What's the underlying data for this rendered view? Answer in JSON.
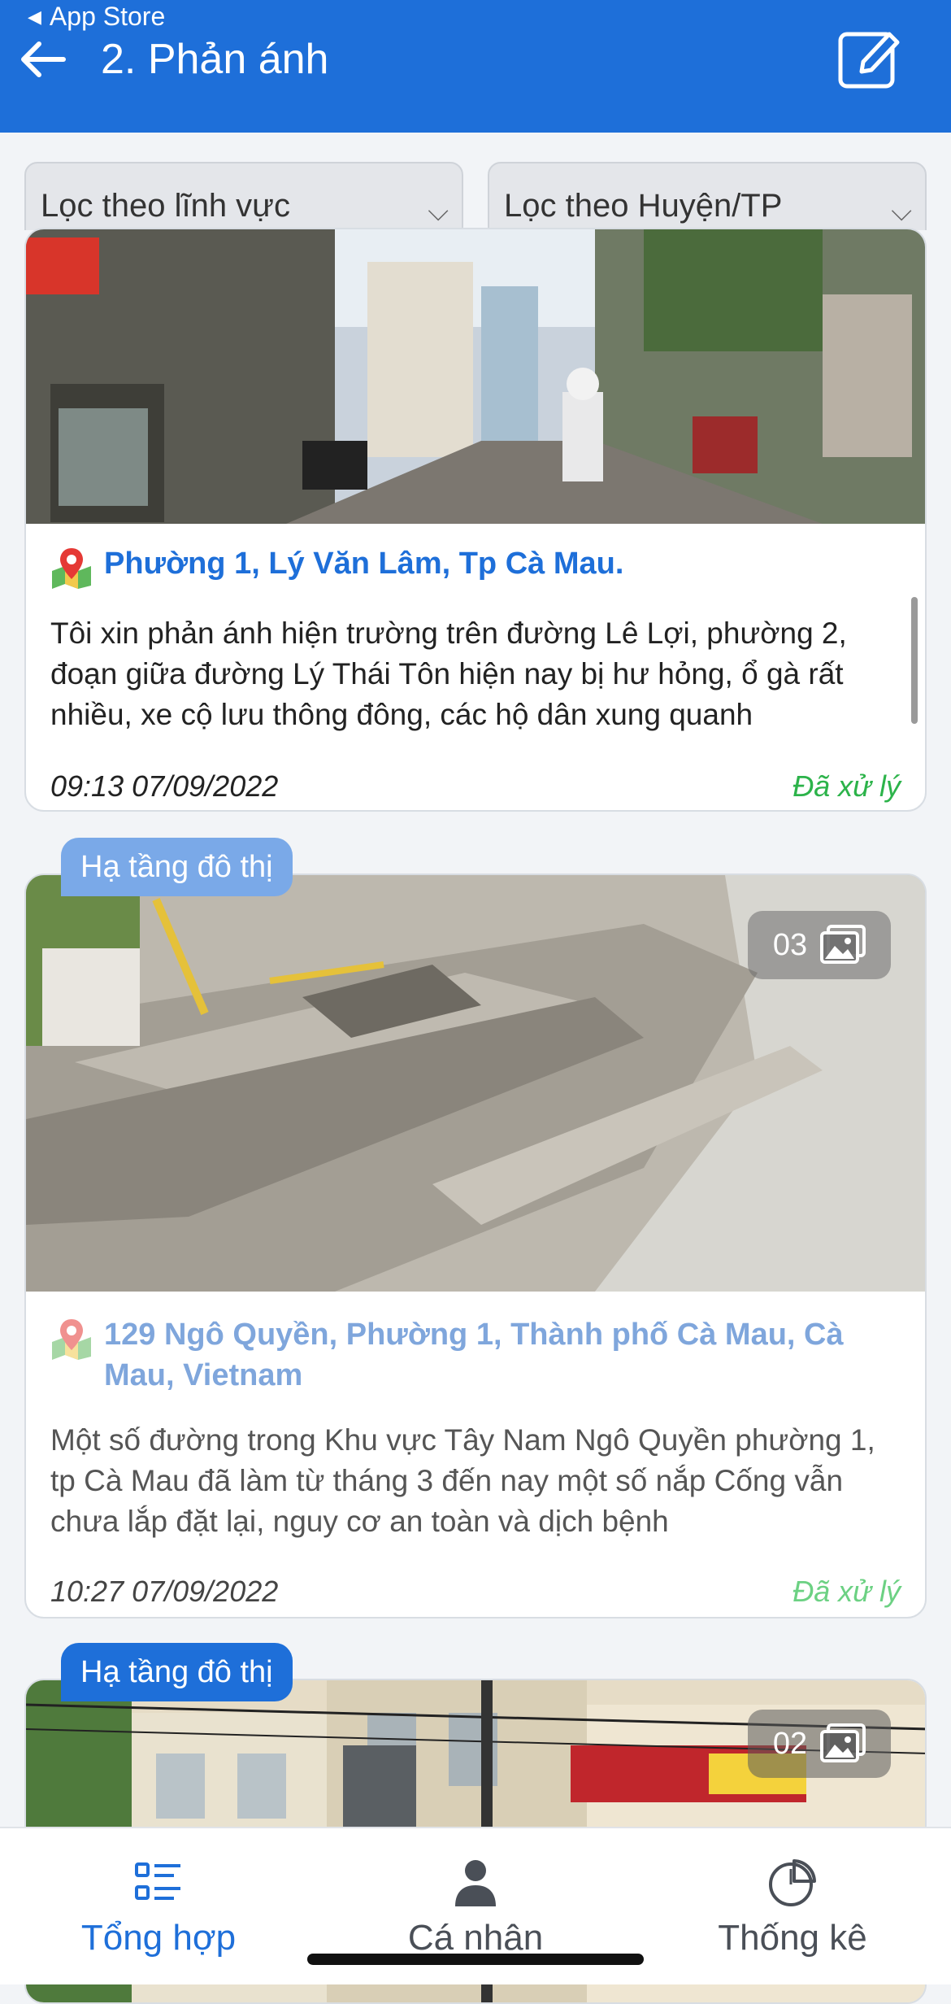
{
  "status_bar": {
    "back_label": "App Store"
  },
  "header": {
    "title": "2. Phản ánh"
  },
  "filters": [
    {
      "label": "Lọc theo lĩnh vực"
    },
    {
      "label": "Lọc theo Huyện/TP"
    }
  ],
  "posts": [
    {
      "address": "Phường 1, Lý Văn Lâm, Tp Cà Mau.",
      "description": "Tôi xin phản ánh hiện trường trên đường Lê Lợi, phường 2, đoạn giữa đường Lý Thái Tôn hiện nay bị hư hỏng, ổ gà rất nhiều, xe cộ lưu thông đông, các hộ dân xung quanh",
      "time": "09:13 07/09/2022",
      "status": "Đã xử lý"
    },
    {
      "category": "Hạ tầng đô thị",
      "image_count": "03",
      "address": "129 Ngô Quyền, Phường 1, Thành phố Cà Mau, Cà Mau, Vietnam",
      "description": "Một số đường trong Khu vực Tây Nam Ngô Quyền phường 1, tp Cà Mau đã làm từ tháng 3 đến nay một số nắp Cống vẫn chưa lắp đặt lại, nguy cơ an toàn và dịch bệnh",
      "time": "10:27 07/09/2022",
      "status": "Đã xử lý"
    },
    {
      "category": "Hạ tầng đô thị",
      "image_count": "02"
    }
  ],
  "bottom_nav": [
    {
      "label": "Tổng hợp",
      "icon": "list-icon",
      "active": true
    },
    {
      "label": "Cá nhân",
      "icon": "person-icon"
    },
    {
      "label": "Thống kê",
      "icon": "pie-chart-icon"
    }
  ],
  "colors": {
    "primary": "#1e6fd9",
    "status_done": "#2cb34a"
  }
}
